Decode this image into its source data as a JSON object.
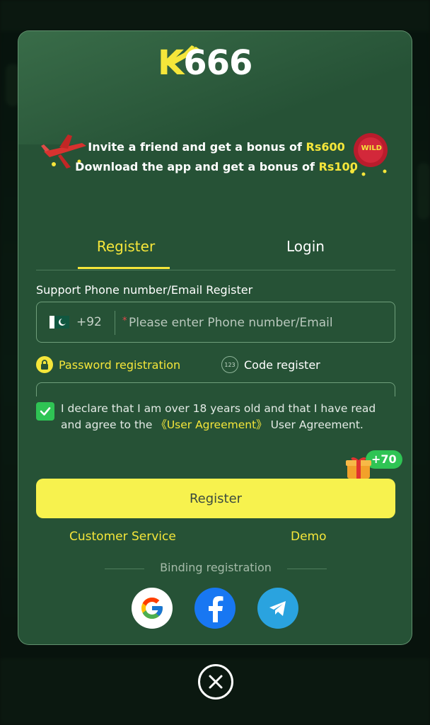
{
  "logo": {
    "k": "K",
    "digits": "666"
  },
  "promo": {
    "line1_text": "Invite a friend and get a bonus of ",
    "line1_amount": "Rs600",
    "line2_text": "Download the app and get a bonus of ",
    "line2_amount": "Rs100",
    "wild_badge": "WILD"
  },
  "tabs": [
    {
      "label": "Register",
      "active": true
    },
    {
      "label": "Login",
      "active": false
    }
  ],
  "form": {
    "support_label": "Support Phone number/Email Register",
    "country_code": "+92",
    "phone_placeholder": "Please enter Phone number/Email",
    "option_password": "Password registration",
    "option_code": "Code register",
    "code_badge": "123"
  },
  "agreement": {
    "checked": true,
    "text_before": "I declare that I am over 18 years old and that I have read and agree to the ",
    "link": "《User Agreement》",
    "text_after": " User Agreement."
  },
  "bonus_tag": "+70",
  "register_button": "Register",
  "links": {
    "customer_service": "Customer Service",
    "demo": "Demo"
  },
  "binding_label": "Binding registration",
  "social": [
    "google-icon",
    "facebook-icon",
    "telegram-icon"
  ],
  "colors": {
    "accent": "#f5e63a",
    "modal_bg": "#265236",
    "button_bg": "#f7f24e",
    "check_green": "#2fc454",
    "facebook": "#1877f2",
    "telegram": "#2aa3df"
  }
}
